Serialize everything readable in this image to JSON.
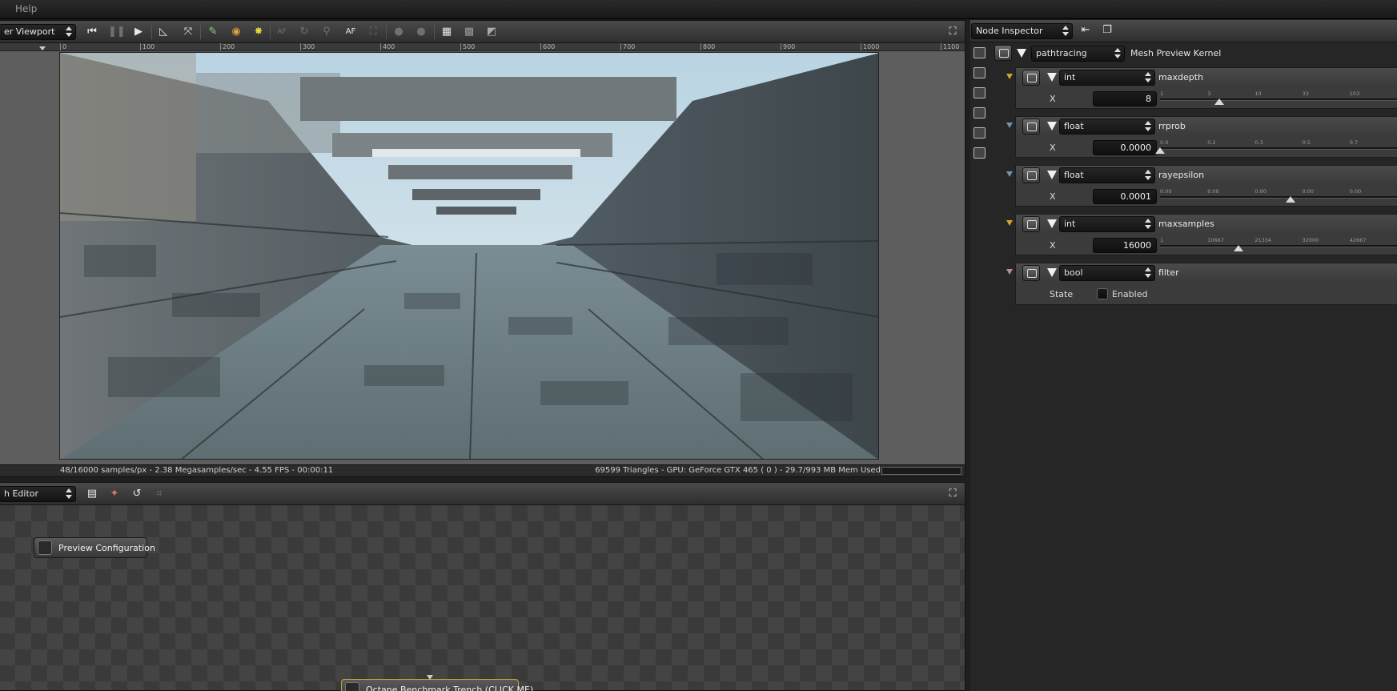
{
  "menubar": {
    "help": "Help"
  },
  "viewport": {
    "selector": "er Viewport",
    "toolbar_text_af": "AF",
    "toolbar_text_af_dim": "AF",
    "ruler": [
      "0",
      "100",
      "200",
      "300",
      "400",
      "500",
      "600",
      "700",
      "800",
      "900",
      "1000",
      "1100"
    ],
    "status_left": "48/16000 samples/px - 2.38 Megasamples/sec - 4.55 FPS - 00:00:11",
    "status_right": "69599 Triangles - GPU: GeForce GTX 465 ( 0 ) - 29.7/993 MB Mem Used"
  },
  "graph_editor": {
    "selector": "h Editor",
    "nodes": [
      {
        "label": "Preview Configuration"
      },
      {
        "label": "Octane Benchmark Trench (CLICK ME)"
      }
    ]
  },
  "inspector": {
    "selector": "Node Inspector",
    "kernel_combo": "pathtracing",
    "kernel_label": "Mesh Preview Kernel",
    "params": [
      {
        "type": "int",
        "name": "maxdepth",
        "row_label": "X",
        "value": "8",
        "scale": [
          "1",
          "3",
          "10",
          "33",
          "103"
        ],
        "level": 0.25
      },
      {
        "type": "float",
        "name": "rrprob",
        "row_label": "X",
        "value": "0.0000",
        "scale": [
          "0.0",
          "0.2",
          "0.3",
          "0.5",
          "0.7"
        ],
        "level": 0.0
      },
      {
        "type": "float",
        "name": "rayepsilon",
        "row_label": "X",
        "value": "0.0001",
        "scale": [
          "0.00",
          "0.00",
          "0.00",
          "0.00",
          "0.00"
        ],
        "level": 0.55
      },
      {
        "type": "int",
        "name": "maxsamples",
        "row_label": "X",
        "value": "16000",
        "scale": [
          "1",
          "10667",
          "21334",
          "32000",
          "42667"
        ],
        "level": 0.33
      }
    ],
    "filter": {
      "type": "bool",
      "name": "filter",
      "row_label": "State",
      "checkbox_label": "Enabled",
      "checked": false
    }
  }
}
